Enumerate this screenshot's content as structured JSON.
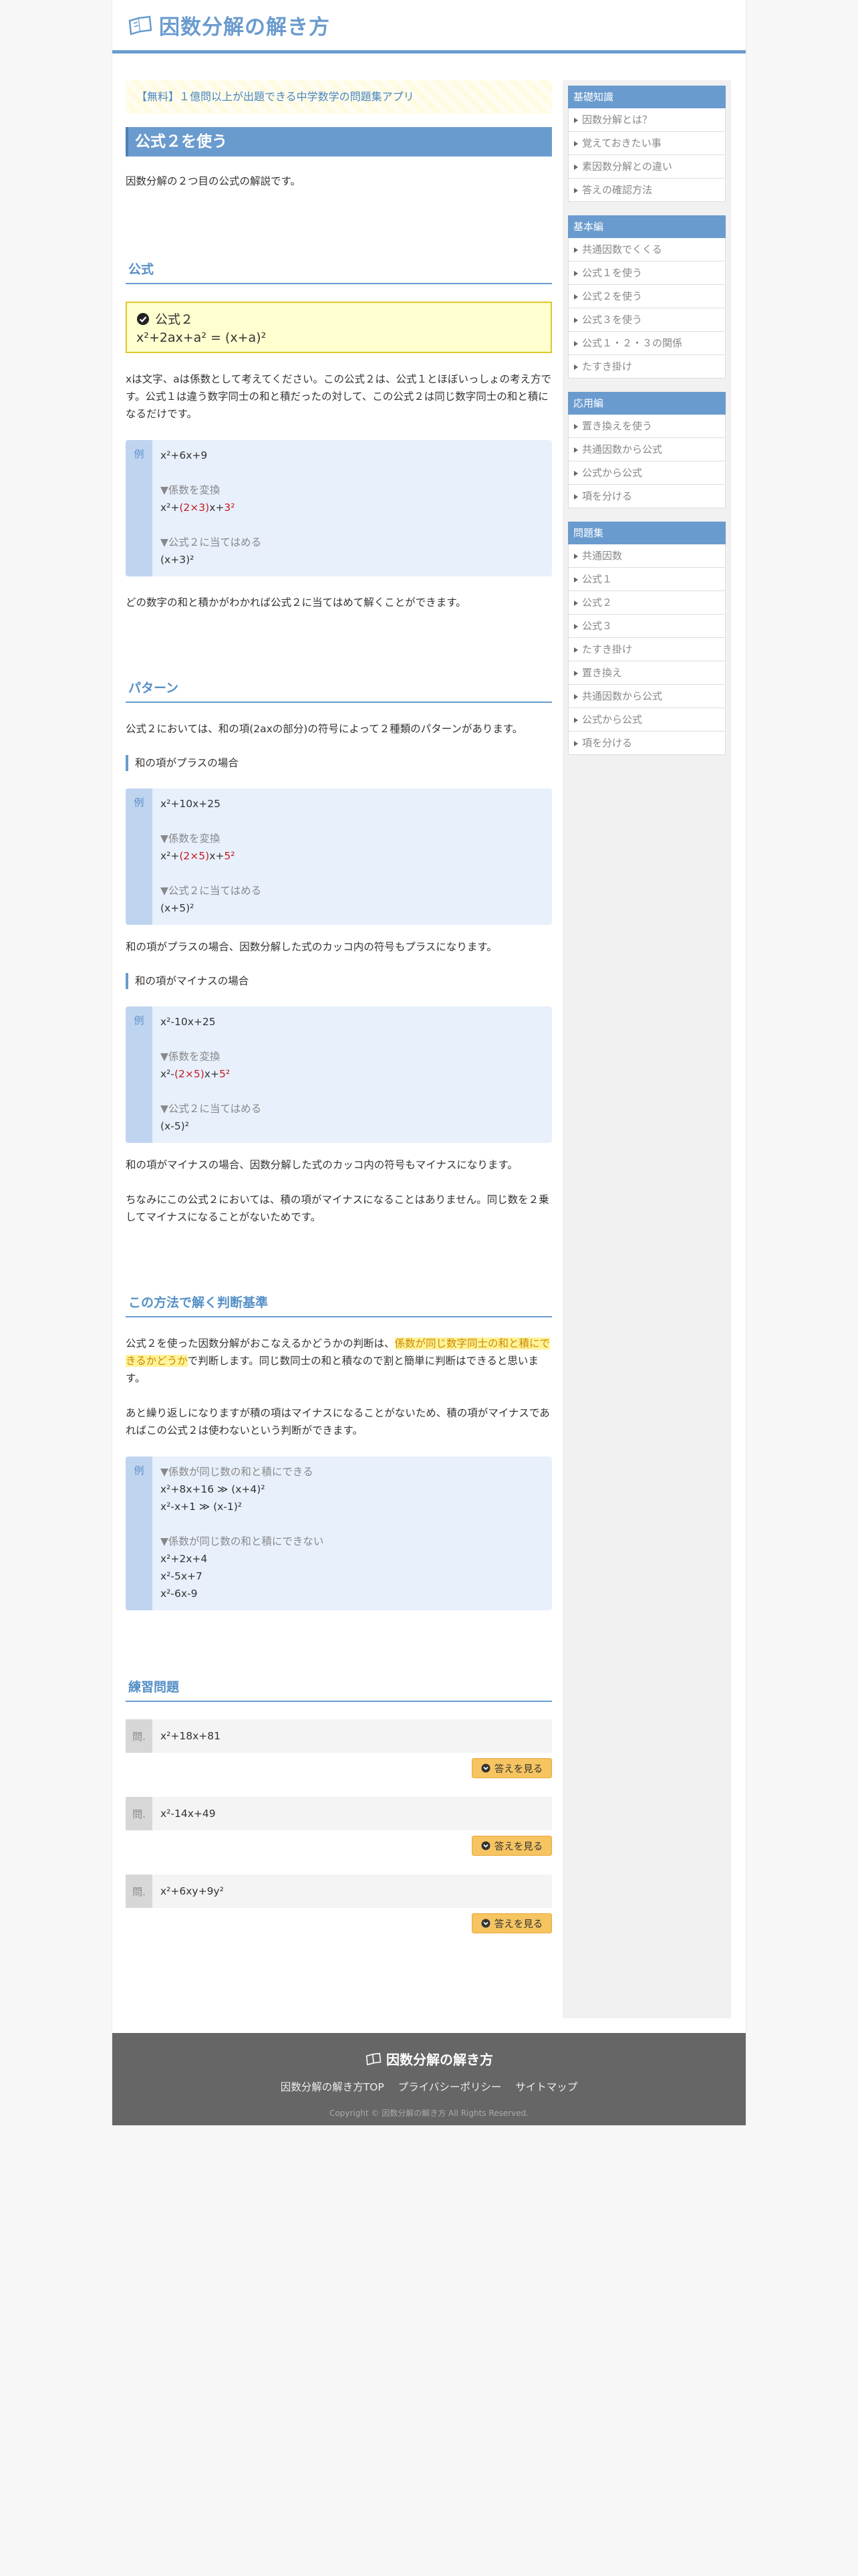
{
  "site": {
    "title": "因数分解の解き方"
  },
  "promo": "【無料】１億問以上が出題できる中学数学の問題集アプリ",
  "page": {
    "title": "公式２を使う",
    "intro": "因数分解の２つ目の公式の解説です。"
  },
  "sec_formula": {
    "heading": "公式",
    "box_title": "公式２",
    "box_eq": "x²+2ax+a² = (x+a)²",
    "desc": "xは文字、aは係数として考えてください。この公式２は、公式１とほぼいっしょの考え方です。公式１は違う数字同士の和と積だったの対して、この公式２は同じ数字同士の和と積になるだけです。",
    "ex_tag": "例",
    "ex_line1": "x²+6x+9",
    "ex_step1": "▼係数を変換",
    "ex_line2a": "x²+",
    "ex_line2b": "(2×3)",
    "ex_line2c": "x+",
    "ex_line2d": "3²",
    "ex_step2": "▼公式２に当てはめる",
    "ex_line3": "(x+3)²",
    "after": "どの数字の和と積かがわかれば公式２に当てはめて解くことができます。"
  },
  "sec_pattern": {
    "heading": "パターン",
    "intro": "公式２においては、和の項(2axの部分)の符号によって２種類のパターンがあります。",
    "plus_head": "和の項がプラスの場合",
    "plus_ex": {
      "tag": "例",
      "l1": "x²+10x+25",
      "s1": "▼係数を変換",
      "l2a": "x²+",
      "l2b": "(2×5)",
      "l2c": "x+",
      "l2d": "5²",
      "s2": "▼公式２に当てはめる",
      "l3": "(x+5)²"
    },
    "plus_after": "和の項がプラスの場合、因数分解した式のカッコ内の符号もプラスになります。",
    "minus_head": "和の項がマイナスの場合",
    "minus_ex": {
      "tag": "例",
      "l1": "x²-10x+25",
      "s1": "▼係数を変換",
      "l2a": "x²-",
      "l2b": "(2×5)",
      "l2c": "x+",
      "l2d": "5²",
      "s2": "▼公式２に当てはめる",
      "l3": "(x-5)²"
    },
    "minus_after": "和の項がマイナスの場合、因数分解した式のカッコ内の符号もマイナスになります。",
    "note": "ちなみにこの公式２においては、積の項がマイナスになることはありません。同じ数を２乗してマイナスになることがないためです。"
  },
  "sec_judge": {
    "heading": "この方法で解く判断基準",
    "p1a": "公式２を使った因数分解がおこなえるかどうかの判断は、",
    "p1b": "係数が同じ数字同士の和と積にできるかどうか",
    "p1c": "で判断します。同じ数同士の和と積なので割と簡単に判断はできると思います。",
    "p2": "あと繰り返しになりますが積の項はマイナスになることがないため、積の項がマイナスであればこの公式２は使わないという判断ができます。",
    "ex_tag": "例",
    "can_head": "▼係数が同じ数の和と積にできる",
    "can_1": "x²+8x+16 ≫ (x+4)²",
    "can_2": "x²-x+1 ≫ (x-1)²",
    "cannot_head": "▼係数が同じ数の和と積にできない",
    "cannot_1": "x²+2x+4",
    "cannot_2": "x²-5x+7",
    "cannot_3": "x²-6x-9"
  },
  "sec_practice": {
    "heading": "練習問題",
    "q_tag": "問.",
    "answer_label": "答えを見る",
    "questions": [
      "x²+18x+81",
      "x²-14x+49",
      "x²+6xy+9y²"
    ]
  },
  "sidebar": {
    "sections": [
      {
        "head": "基礎知識",
        "items": [
          "因数分解とは？",
          "覚えておきたい事",
          "素因数分解との違い",
          "答えの確認方法"
        ]
      },
      {
        "head": "基本編",
        "items": [
          "共通因数でくくる",
          "公式１を使う",
          "公式２を使う",
          "公式３を使う",
          "公式１・２・３の関係",
          "たすき掛け"
        ]
      },
      {
        "head": "応用編",
        "items": [
          "置き換えを使う",
          "共通因数から公式",
          "公式から公式",
          "項を分ける"
        ]
      },
      {
        "head": "問題集",
        "items": [
          "共通因数",
          "公式１",
          "公式２",
          "公式３",
          "たすき掛け",
          "置き換え",
          "共通因数から公式",
          "公式から公式",
          "項を分ける"
        ]
      }
    ]
  },
  "footer": {
    "title": "因数分解の解き方",
    "links": [
      "因数分解の解き方TOP",
      "プライバシーポリシー",
      "サイトマップ"
    ],
    "copyright": "Copyright © 因数分解の解き方 All Rights Reserved."
  },
  "colors": {
    "accent": "#6a9bce",
    "formula_bg": "#ffffcf",
    "example_bg": "#e8f0fc",
    "answer_button": "#f6c460",
    "footer_bg": "#666666"
  }
}
